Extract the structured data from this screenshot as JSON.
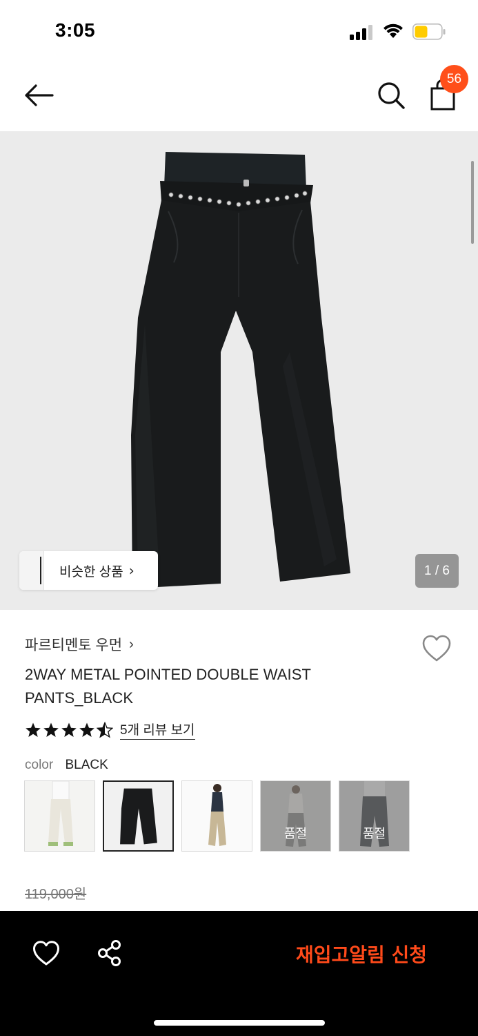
{
  "status": {
    "time": "3:05"
  },
  "nav": {
    "cart_count": "56"
  },
  "gallery": {
    "similar_label": "비슷한 상품",
    "page_counter": "1 / 6"
  },
  "product": {
    "brand": "파르티멘토 우먼",
    "title": "2WAY METAL POINTED DOUBLE WAIST PANTS_BLACK",
    "rating_stars": 4.5,
    "review_link": "5개 리뷰 보기",
    "color_label": "color",
    "color_value": "BLACK",
    "original_price": "119,000원"
  },
  "swatches": [
    {
      "name": "ivory",
      "soldout": false,
      "selected": false
    },
    {
      "name": "black",
      "soldout": false,
      "selected": true
    },
    {
      "name": "beige",
      "soldout": false,
      "selected": false
    },
    {
      "name": "light-gray",
      "soldout": true,
      "selected": false,
      "soldout_label": "품절"
    },
    {
      "name": "charcoal",
      "soldout": true,
      "selected": false,
      "soldout_label": "품절"
    }
  ],
  "bottom_bar": {
    "restock_label": "재입고알림 신청"
  },
  "colors": {
    "accent": "#ff4f1a",
    "bottom_bar_bg": "#000000"
  }
}
